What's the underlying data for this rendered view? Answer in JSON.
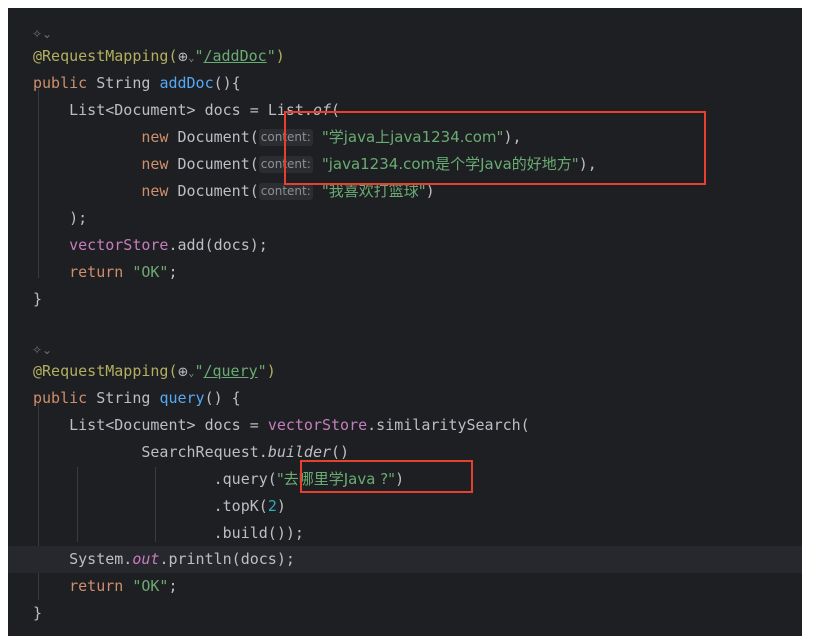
{
  "editor": {
    "gutter_icon": "lightbulb-icon",
    "colors": {
      "background": "#1e1f22",
      "keyword": "#cf8e6d",
      "string": "#6aab73",
      "function": "#56a8f5",
      "annotation": "#b3ae60",
      "highlight_box": "#e8402e"
    },
    "add_doc": {
      "annotation": "@RequestMapping(",
      "globe": "⊕",
      "dropdown": "⌄",
      "path": "/addDoc",
      "annotation_end": ")",
      "sig_kw": "public ",
      "sig_type": "String ",
      "sig_name": "addDoc",
      "sig_end": "(){",
      "decl_start": "List<Document> docs = ",
      "decl_list": "List.",
      "decl_of": "of",
      "decl_end": "(",
      "new_kw": "new ",
      "doc_ctor": "Document(",
      "param_hint": "content:",
      "doc1": "\"学java上java1234.com\"",
      "doc2": "\"java1234.com是个学Java的好地方\"",
      "doc3": "\"我喜欢打篮球\"",
      "comma": ",",
      "close_list": ");",
      "add_target": "vectorStore",
      "add_call": ".add(docs);",
      "return_kw": "return ",
      "return_val": "\"OK\"",
      "semicolon": ";",
      "close_brace": "}"
    },
    "query": {
      "annotation": "@RequestMapping(",
      "globe": "⊕",
      "dropdown": "⌄",
      "path": "/query",
      "annotation_end": ")",
      "sig_kw": "public ",
      "sig_type": "String ",
      "sig_name": "query",
      "sig_end": "() {",
      "decl_start": "List<Document> docs = ",
      "decl_target": "vectorStore",
      "decl_call": ".similaritySearch(",
      "builder_cls": "SearchRequest.",
      "builder_fn": "builder",
      "builder_end": "()",
      "query_call": ".query(",
      "query_arg": "\"去哪里学Java ?\"",
      "close_paren": ")",
      "topk_call": ".topK(",
      "topk_arg": "2",
      "build_call": ".build());",
      "print_cls": "System.",
      "print_field": "out",
      "print_call": ".println(docs);",
      "return_kw": "return ",
      "return_val": "\"OK\"",
      "semicolon": ";",
      "close_brace": "}"
    }
  }
}
